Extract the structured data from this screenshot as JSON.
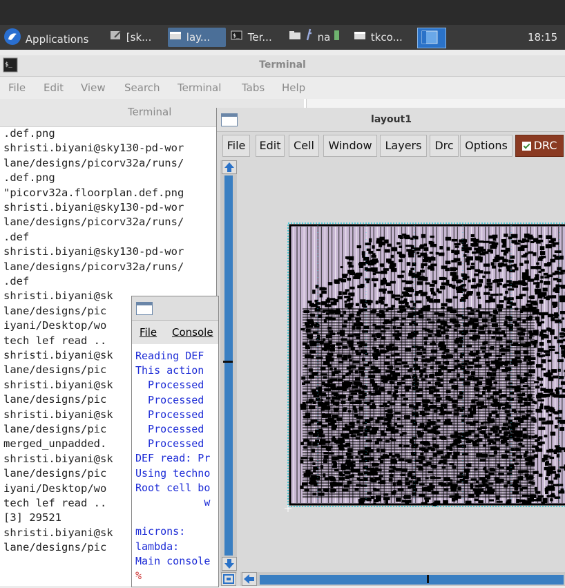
{
  "taskbar": {
    "applications": "Applications",
    "items": [
      "[sk...",
      "lay...",
      "Ter...",
      "na",
      "tkco..."
    ],
    "clock": "18:15"
  },
  "terminal": {
    "title": "Terminal",
    "menu": [
      "File",
      "Edit",
      "View",
      "Search",
      "Terminal",
      "Tabs",
      "Help"
    ],
    "tab_label": "Terminal",
    "lines": [
      ".def.png",
      "shristi.biyani@sky130-pd-wor",
      "lane/designs/picorv32a/runs/",
      ".def.png",
      "\"picorv32a.floorplan.def.png",
      "shristi.biyani@sky130-pd-wor",
      "lane/designs/picorv32a/runs/",
      ".def",
      "shristi.biyani@sky130-pd-wor",
      "lane/designs/picorv32a/runs/",
      ".def",
      "shristi.biyani@sk",
      "lane/designs/pic",
      "iyani/Desktop/wo",
      "tech lef read ..",
      "shristi.biyani@sk",
      "lane/designs/pic",
      "shristi.biyani@sk",
      "lane/designs/pic",
      "shristi.biyani@sk",
      "lane/designs/pic",
      "merged_unpadded.",
      "shristi.biyani@sk",
      "lane/designs/pic",
      "iyani/Desktop/wo",
      "tech lef read ..",
      "[3] 29521",
      "shristi.biyani@sk",
      "lane/designs/pic"
    ]
  },
  "layout_window": {
    "title": "layout1",
    "menu": [
      "File",
      "Edit",
      "Cell",
      "Window",
      "Layers",
      "Drc",
      "Options"
    ],
    "drc_label": "DRC"
  },
  "tkcon": {
    "menu": [
      "File",
      "Console"
    ],
    "lines": [
      "Reading DEF",
      "This action",
      "  Processed",
      "  Processed",
      "  Processed",
      "  Processed",
      "  Processed",
      "DEF read: Pr",
      "Using techno",
      "Root cell bo",
      "           w",
      "",
      "microns:",
      "lambda:",
      "Main console",
      "%"
    ]
  },
  "colors": {
    "taskbar_bg": "#3a3a3a",
    "active_task": "#4b6f98",
    "drc_button": "#8a3a22",
    "scrollbar": "#3a7fc2",
    "console_text": "#1c2bd6",
    "layout_die": "#c9b8d4",
    "layout_cells": "#000000",
    "layout_grid": "#22c4d4"
  },
  "icons": [
    "xfce-mouse-icon",
    "text-editor-icon",
    "window-icon",
    "terminal-icon",
    "folder-icon",
    "inkscape-icon",
    "window-icon",
    "workspace-icon"
  ]
}
